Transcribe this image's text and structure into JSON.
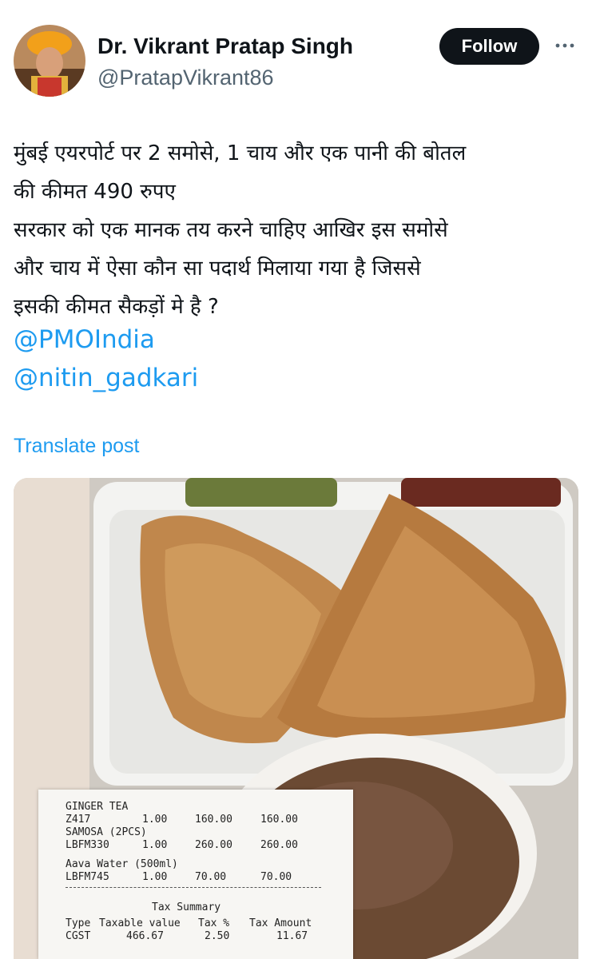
{
  "author": {
    "name": "Dr. Vikrant Pratap Singh",
    "handle": "@PratapVikrant86",
    "follow_label": "Follow",
    "more_icon": "more-dots-icon"
  },
  "post": {
    "lines": [
      "मुंबई एयरपोर्ट पर 2 समोसे, 1 चाय और एक पानी की बोतल",
      "की कीमत 490 रुपए",
      "सरकार को एक मानक तय करने चाहिए आखिर इस समोसे",
      "और चाय में ऐसा कौन सा पदार्थ मिलाया गया है जिससे",
      "इसकी कीमत सैकड़ों मे है ?"
    ],
    "mentions": [
      "@PMOIndia",
      "@nitin_gadkari"
    ],
    "translate_label": "Translate post"
  },
  "receipt": {
    "items": [
      {
        "name": "GINGER TEA",
        "code": "Z417",
        "qty": "1.00",
        "rate": "160.00",
        "amount": "160.00"
      },
      {
        "name": "SAMOSA (2PCS)",
        "code": "LBFM330",
        "qty": "1.00",
        "rate": "260.00",
        "amount": "260.00"
      },
      {
        "name": "Aava Water (500ml)",
        "code": "LBFM745",
        "qty": "1.00",
        "rate": "70.00",
        "amount": "70.00"
      }
    ],
    "tax_title": "Tax Summary",
    "tax_headers": [
      "Type",
      "Taxable value",
      "Tax %",
      "Tax Amount"
    ],
    "tax_row": [
      "CGST",
      "466.67",
      "2.50",
      "11.67"
    ]
  },
  "colors": {
    "link": "#1d9bf0",
    "text": "#0f1419",
    "muted": "#536471",
    "button_bg": "#0f1419"
  }
}
